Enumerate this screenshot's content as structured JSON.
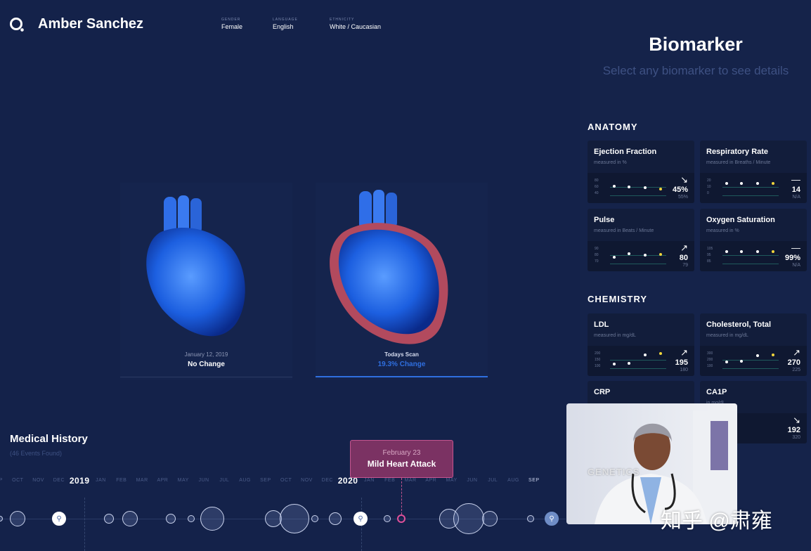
{
  "header": {
    "name": "Amber Sanchez",
    "meta": [
      {
        "key": "GENDER",
        "value": "Female"
      },
      {
        "key": "LANGUAGE",
        "value": "English"
      },
      {
        "key": "ETHNICITY",
        "value": "White / Caucasian"
      }
    ]
  },
  "scans": [
    {
      "date": "January 12, 2019",
      "label": "No Change",
      "selected": false
    },
    {
      "date": "Todays Scan",
      "label": "19.3% Change",
      "selected": true
    }
  ],
  "biomarker": {
    "title": "Biomarker",
    "subtitle": "Select any biomarker to see details",
    "sections": [
      {
        "title": "ANATOMY",
        "cards": [
          {
            "name": "Ejection Fraction",
            "unit": "measured in %",
            "yticks": [
              "80",
              "60",
              "40"
            ],
            "trend": "down",
            "value": "45%",
            "previous": "55%",
            "points": [
              60,
              58,
              55,
              52
            ]
          },
          {
            "name": "Respiratory Rate",
            "unit": "measured in Breaths / Minute",
            "yticks": [
              "20",
              "10",
              "0"
            ],
            "trend": "flat",
            "value": "14",
            "previous": "N/A",
            "points": [
              14,
              14,
              14,
              14
            ]
          },
          {
            "name": "Pulse",
            "unit": "measured in Beats / Minute",
            "yticks": [
              "90",
              "80",
              "70"
            ],
            "trend": "up",
            "value": "80",
            "previous": "79",
            "points": [
              76,
              81,
              79,
              80
            ]
          },
          {
            "name": "Oxygen Saturation",
            "unit": "measured in %",
            "yticks": [
              "105",
              "95",
              "85"
            ],
            "trend": "flat",
            "value": "99%",
            "previous": "N/A",
            "points": [
              99,
              99,
              99,
              99
            ]
          }
        ]
      },
      {
        "title": "CHEMISTRY",
        "cards": [
          {
            "name": "LDL",
            "unit": "measured in mg/dL",
            "yticks": [
              "200",
              "150",
              "100"
            ],
            "trend": "up",
            "value": "195",
            "previous": "180",
            "points": [
              110,
              115,
              185,
              195
            ]
          },
          {
            "name": "Cholesterol, Total",
            "unit": "measured in mg/dL",
            "yticks": [
              "300",
              "200",
              "100"
            ],
            "trend": "up",
            "value": "270",
            "previous": "225",
            "points": [
              160,
              165,
              255,
              270
            ]
          },
          {
            "name": "CRP",
            "unit": "",
            "yticks": [],
            "trend": "up",
            "value": "",
            "previous": "",
            "points": []
          },
          {
            "name": "CA1P",
            "unit": "in mg/dL",
            "yticks": [],
            "trend": "down",
            "value": "192",
            "previous": "320",
            "points": []
          }
        ]
      },
      {
        "title": "GENETICS",
        "cards": []
      }
    ]
  },
  "history": {
    "title": "Medical History",
    "count": "(46 Events Found)",
    "months": [
      "SEP",
      "OCT",
      "NOV",
      "DEC",
      "2019",
      "JAN",
      "FEB",
      "MAR",
      "APR",
      "MAY",
      "JUN",
      "JUL",
      "AUG",
      "SEP",
      "OCT",
      "NOV",
      "DEC",
      "2020",
      "JAN",
      "FEB",
      "MAR",
      "APR",
      "MAY",
      "JUN",
      "JUL",
      "AUG",
      "SEP"
    ],
    "tooltip": {
      "date": "February 23",
      "event": "Mild Heart Attack"
    }
  },
  "watermark": "知乎 @肃雍",
  "colors": {
    "background": "#14224a",
    "current_point": "#f1d53c",
    "selected": "#2f6fe0",
    "event_highlight": "#7b3263"
  }
}
